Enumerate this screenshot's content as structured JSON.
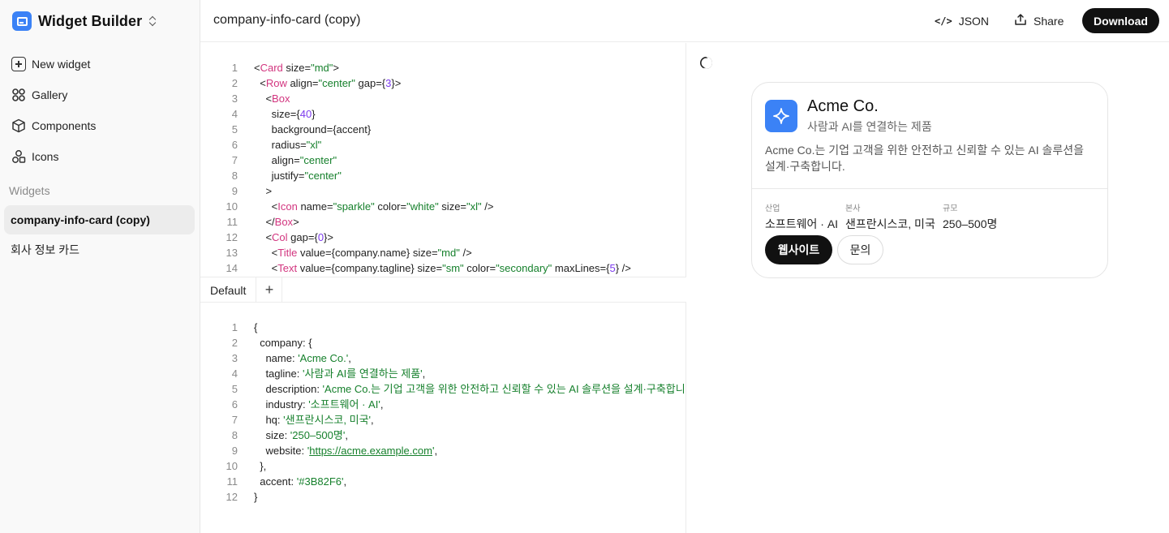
{
  "sidebar": {
    "app_title": "Widget Builder",
    "nav": [
      {
        "label": "New widget",
        "icon": "plus-square-icon"
      },
      {
        "label": "Gallery",
        "icon": "gallery-icon"
      },
      {
        "label": "Components",
        "icon": "cube-icon"
      },
      {
        "label": "Icons",
        "icon": "shapes-icon"
      }
    ],
    "section_label": "Widgets",
    "widgets": [
      {
        "label": "company-info-card (copy)",
        "active": true
      },
      {
        "label": "회사 정보 카드",
        "active": false
      }
    ]
  },
  "header": {
    "title": "company-info-card (copy)",
    "json_label": "JSON",
    "share_label": "Share",
    "download_label": "Download"
  },
  "template_editor": {
    "lines": [
      {
        "n": "1",
        "segs": [
          [
            "p",
            "<"
          ],
          [
            "t",
            "Card"
          ],
          [
            "p",
            " size="
          ],
          [
            "s",
            "\"md\""
          ],
          [
            "p",
            ">"
          ]
        ]
      },
      {
        "n": "2",
        "segs": [
          [
            "p",
            "  <"
          ],
          [
            "t",
            "Row"
          ],
          [
            "p",
            " align="
          ],
          [
            "s",
            "\"center\""
          ],
          [
            "p",
            " gap={"
          ],
          [
            "v",
            "3"
          ],
          [
            "p",
            "}>"
          ]
        ]
      },
      {
        "n": "3",
        "segs": [
          [
            "p",
            "    <"
          ],
          [
            "t",
            "Box"
          ]
        ]
      },
      {
        "n": "4",
        "segs": [
          [
            "p",
            "      size={"
          ],
          [
            "v",
            "40"
          ],
          [
            "p",
            "}"
          ]
        ]
      },
      {
        "n": "5",
        "segs": [
          [
            "p",
            "      background={accent}"
          ]
        ]
      },
      {
        "n": "6",
        "segs": [
          [
            "p",
            "      radius="
          ],
          [
            "s",
            "\"xl\""
          ]
        ]
      },
      {
        "n": "7",
        "segs": [
          [
            "p",
            "      align="
          ],
          [
            "s",
            "\"center\""
          ]
        ]
      },
      {
        "n": "8",
        "segs": [
          [
            "p",
            "      justify="
          ],
          [
            "s",
            "\"center\""
          ]
        ]
      },
      {
        "n": "9",
        "segs": [
          [
            "p",
            "    >"
          ]
        ]
      },
      {
        "n": "10",
        "segs": [
          [
            "p",
            "      <"
          ],
          [
            "t",
            "Icon"
          ],
          [
            "p",
            " name="
          ],
          [
            "s",
            "\"sparkle\""
          ],
          [
            "p",
            " color="
          ],
          [
            "s",
            "\"white\""
          ],
          [
            "p",
            " size="
          ],
          [
            "s",
            "\"xl\""
          ],
          [
            "p",
            " />"
          ]
        ]
      },
      {
        "n": "11",
        "segs": [
          [
            "p",
            "    </"
          ],
          [
            "t",
            "Box"
          ],
          [
            "p",
            ">"
          ]
        ]
      },
      {
        "n": "12",
        "segs": [
          [
            "p",
            "    <"
          ],
          [
            "t",
            "Col"
          ],
          [
            "p",
            " gap={"
          ],
          [
            "v",
            "0"
          ],
          [
            "p",
            "}>"
          ]
        ]
      },
      {
        "n": "13",
        "segs": [
          [
            "p",
            "      <"
          ],
          [
            "t",
            "Title"
          ],
          [
            "p",
            " value={company.name} size="
          ],
          [
            "s",
            "\"md\""
          ],
          [
            "p",
            " />"
          ]
        ]
      },
      {
        "n": "14",
        "segs": [
          [
            "p",
            "      <"
          ],
          [
            "t",
            "Text"
          ],
          [
            "p",
            " value={company.tagline} size="
          ],
          [
            "s",
            "\"sm\""
          ],
          [
            "p",
            " color="
          ],
          [
            "s",
            "\"secondary\""
          ],
          [
            "p",
            " maxLines={"
          ],
          [
            "v",
            "5"
          ],
          [
            "p",
            "} />"
          ]
        ]
      }
    ]
  },
  "tabs": {
    "items": [
      "Default"
    ],
    "add_label": "+"
  },
  "data_editor": {
    "lines": [
      {
        "n": "1",
        "segs": [
          [
            "p",
            "{"
          ]
        ]
      },
      {
        "n": "2",
        "segs": [
          [
            "p",
            "  company: {"
          ]
        ]
      },
      {
        "n": "3",
        "segs": [
          [
            "p",
            "    name: "
          ],
          [
            "s",
            "'Acme Co.'"
          ],
          [
            "p",
            ","
          ]
        ]
      },
      {
        "n": "4",
        "segs": [
          [
            "p",
            "    tagline: "
          ],
          [
            "s",
            "'사람과 AI를 연결하는 제품'"
          ],
          [
            "p",
            ","
          ]
        ]
      },
      {
        "n": "5",
        "segs": [
          [
            "p",
            "    description: "
          ],
          [
            "s",
            "'Acme Co.는 기업 고객을 위한 안전하고 신뢰할 수 있는 AI 솔루션을 설계·구축합니다.'"
          ],
          [
            "p",
            ","
          ]
        ]
      },
      {
        "n": "6",
        "segs": [
          [
            "p",
            "    industry: "
          ],
          [
            "s",
            "'소프트웨어 · AI'"
          ],
          [
            "p",
            ","
          ]
        ]
      },
      {
        "n": "7",
        "segs": [
          [
            "p",
            "    hq: "
          ],
          [
            "s",
            "'샌프란시스코, 미국'"
          ],
          [
            "p",
            ","
          ]
        ]
      },
      {
        "n": "8",
        "segs": [
          [
            "p",
            "    size: "
          ],
          [
            "s",
            "'250–500명'"
          ],
          [
            "p",
            ","
          ]
        ]
      },
      {
        "n": "9",
        "segs": [
          [
            "p",
            "    website: "
          ],
          [
            "s",
            "'"
          ],
          [
            "l",
            "https://acme.example.com"
          ],
          [
            "s",
            "'"
          ],
          [
            "p",
            ","
          ]
        ]
      },
      {
        "n": "10",
        "segs": [
          [
            "p",
            "  },"
          ]
        ]
      },
      {
        "n": "11",
        "segs": [
          [
            "p",
            "  accent: "
          ],
          [
            "s",
            "'#3B82F6'"
          ],
          [
            "p",
            ","
          ]
        ]
      },
      {
        "n": "12",
        "segs": [
          [
            "p",
            "}"
          ]
        ]
      }
    ]
  },
  "preview": {
    "theme_icon": "moon-icon",
    "accent": "#3B82F6",
    "card": {
      "logo_icon": "sparkle-icon",
      "name": "Acme Co.",
      "tagline": "사람과 AI를 연결하는 제품",
      "description": "Acme Co.는 기업 고객을 위한 안전하고 신뢰할 수 있는 AI 솔루션을 설계·구축합니다.",
      "stats": [
        {
          "label": "산업",
          "value": "소프트웨어 · AI"
        },
        {
          "label": "본사",
          "value": "샌프란시스코, 미국"
        },
        {
          "label": "규모",
          "value": "250–500명"
        }
      ],
      "primary_button": "웹사이트",
      "secondary_button": "문의"
    }
  }
}
